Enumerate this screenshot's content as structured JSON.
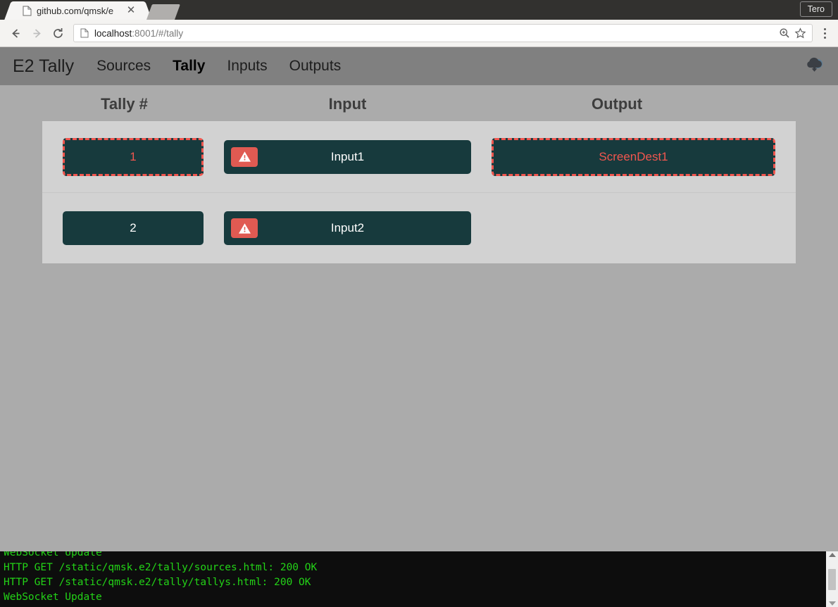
{
  "browser": {
    "tab": {
      "title": "github.com/qmsk/e",
      "favicon_icon": "document-icon",
      "close_icon": "close-icon"
    },
    "profile_label": "Tero",
    "toolbar": {
      "back_icon": "arrow-left-icon",
      "forward_icon": "arrow-right-icon",
      "reload_icon": "reload-icon",
      "page_icon": "document-icon",
      "url_host": "localhost",
      "url_rest": ":8001/#/tally",
      "zoom_icon": "magnifier-icon",
      "bookmark_icon": "star-icon",
      "menu_icon": "kebab-menu-icon"
    }
  },
  "app": {
    "brand": "E2 Tally",
    "nav": [
      {
        "label": "Sources",
        "active": false
      },
      {
        "label": "Tally",
        "active": true
      },
      {
        "label": "Inputs",
        "active": false
      },
      {
        "label": "Outputs",
        "active": false
      }
    ],
    "nav_right_icon": "cloud-download-icon",
    "colors": {
      "button_bg": "#173a3d",
      "alert_border": "#f1564f",
      "alert_text": "#f1564f",
      "badge_bg": "#e05a52",
      "panel_bg": "#d2d2d2",
      "navbar_bg": "#808080",
      "page_bg": "#ababab"
    },
    "table": {
      "headers": [
        "Tally #",
        "Input",
        "Output"
      ],
      "rows": [
        {
          "tally": {
            "label": "1",
            "alert": true,
            "warning": false
          },
          "input": {
            "label": "Input1",
            "alert": false,
            "warning": true
          },
          "output": {
            "label": "ScreenDest1",
            "alert": true,
            "warning": false
          }
        },
        {
          "tally": {
            "label": "2",
            "alert": false,
            "warning": false
          },
          "input": {
            "label": "Input2",
            "alert": false,
            "warning": true
          },
          "output": {
            "label": "",
            "alert": false,
            "warning": false,
            "empty": true
          }
        }
      ]
    }
  },
  "terminal": {
    "lines": [
      "WebSocket Update",
      "HTTP GET /static/qmsk.e2/tally/sources.html: 200 OK",
      "HTTP GET /static/qmsk.e2/tally/tallys.html: 200 OK",
      "WebSocket Update"
    ],
    "scrollbar": {
      "up_icon": "caret-up-icon",
      "down_icon": "caret-down-icon"
    }
  }
}
